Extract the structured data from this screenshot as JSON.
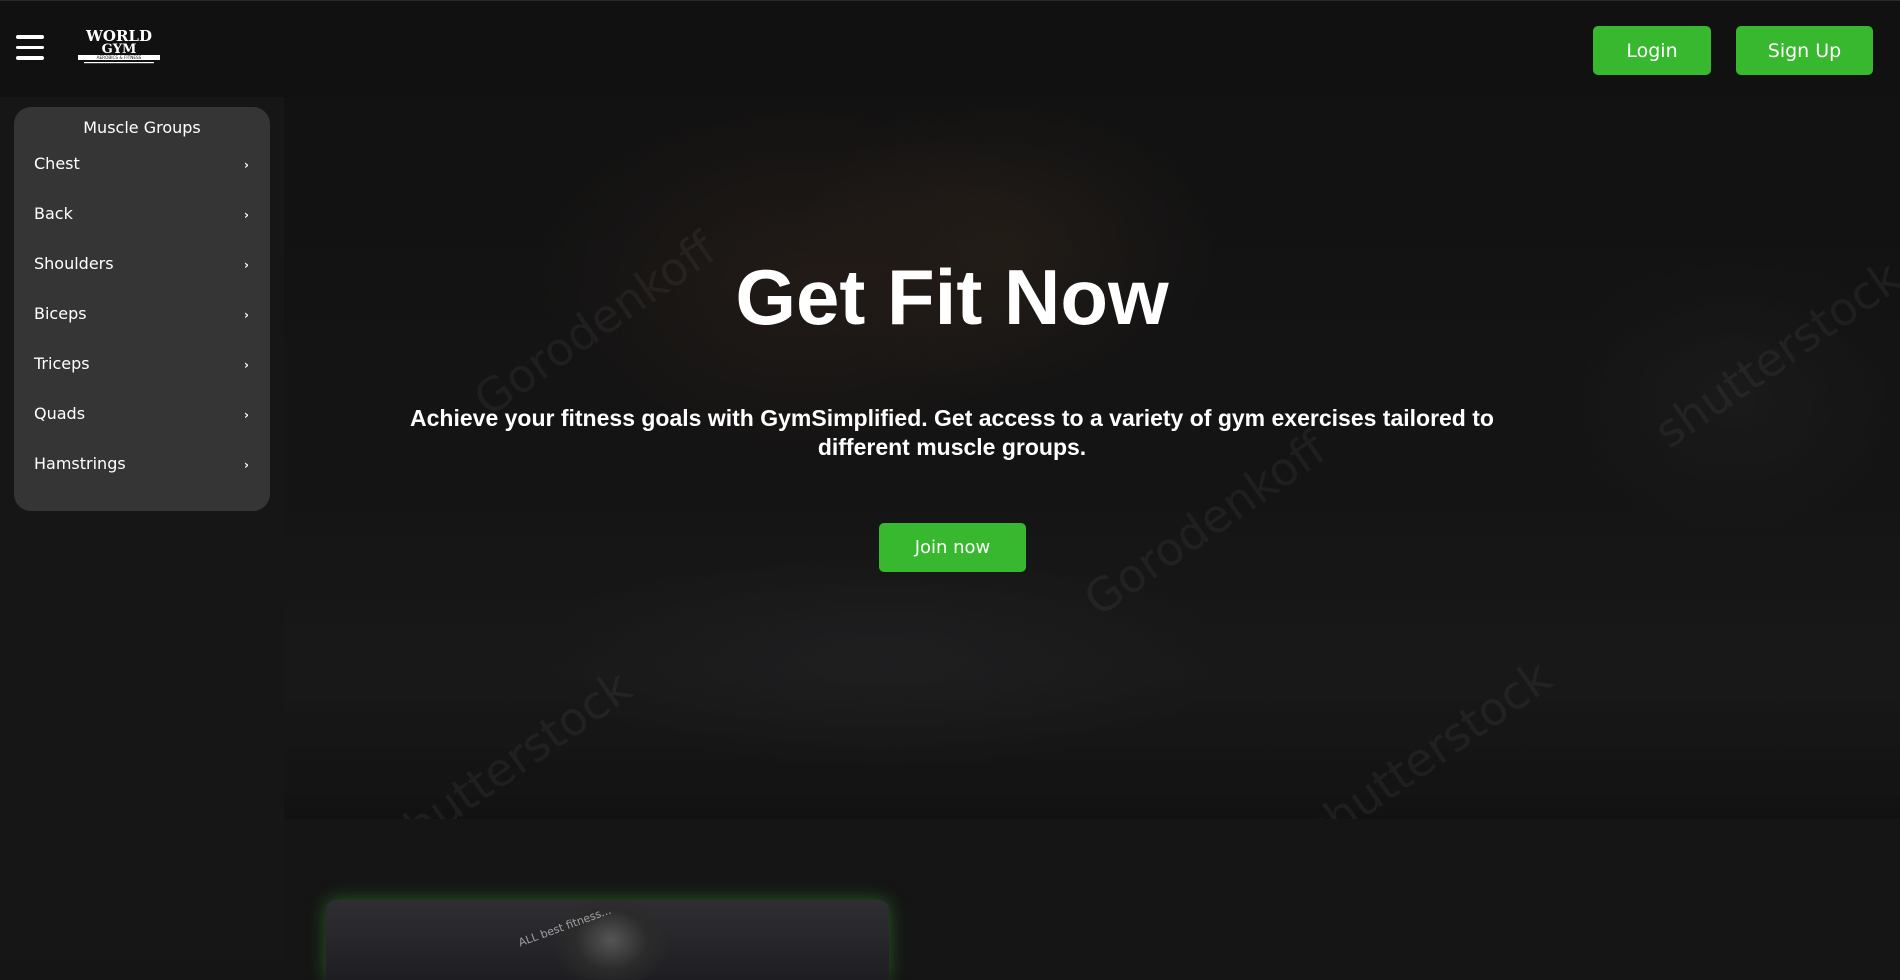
{
  "header": {
    "menu_icon": "hamburger-menu-icon",
    "logo": {
      "line1": "WORLD",
      "line2": "GYM",
      "tagline": "AEROBICS & FITNESS"
    },
    "login_label": "Login",
    "signup_label": "Sign Up",
    "accent_color": "#37b82e"
  },
  "sidebar": {
    "title": "Muscle Groups",
    "items": [
      {
        "label": "Chest",
        "icon": "chevron-right-icon"
      },
      {
        "label": "Back",
        "icon": "chevron-right-icon"
      },
      {
        "label": "Shoulders",
        "icon": "chevron-right-icon"
      },
      {
        "label": "Biceps",
        "icon": "chevron-right-icon"
      },
      {
        "label": "Triceps",
        "icon": "chevron-right-icon"
      },
      {
        "label": "Quads",
        "icon": "chevron-right-icon"
      },
      {
        "label": "Hamstrings",
        "icon": "chevron-right-icon"
      }
    ]
  },
  "hero": {
    "title": "Get Fit Now",
    "subtitle": "Achieve your fitness goals with GymSimplified. Get access to a variety of gym exercises tailored to different muscle groups.",
    "cta_label": "Join now",
    "watermark": "shutterstock",
    "watermark2": "Gorodenkoff"
  },
  "content": {
    "card_watermark": "ALL best fitness..."
  }
}
